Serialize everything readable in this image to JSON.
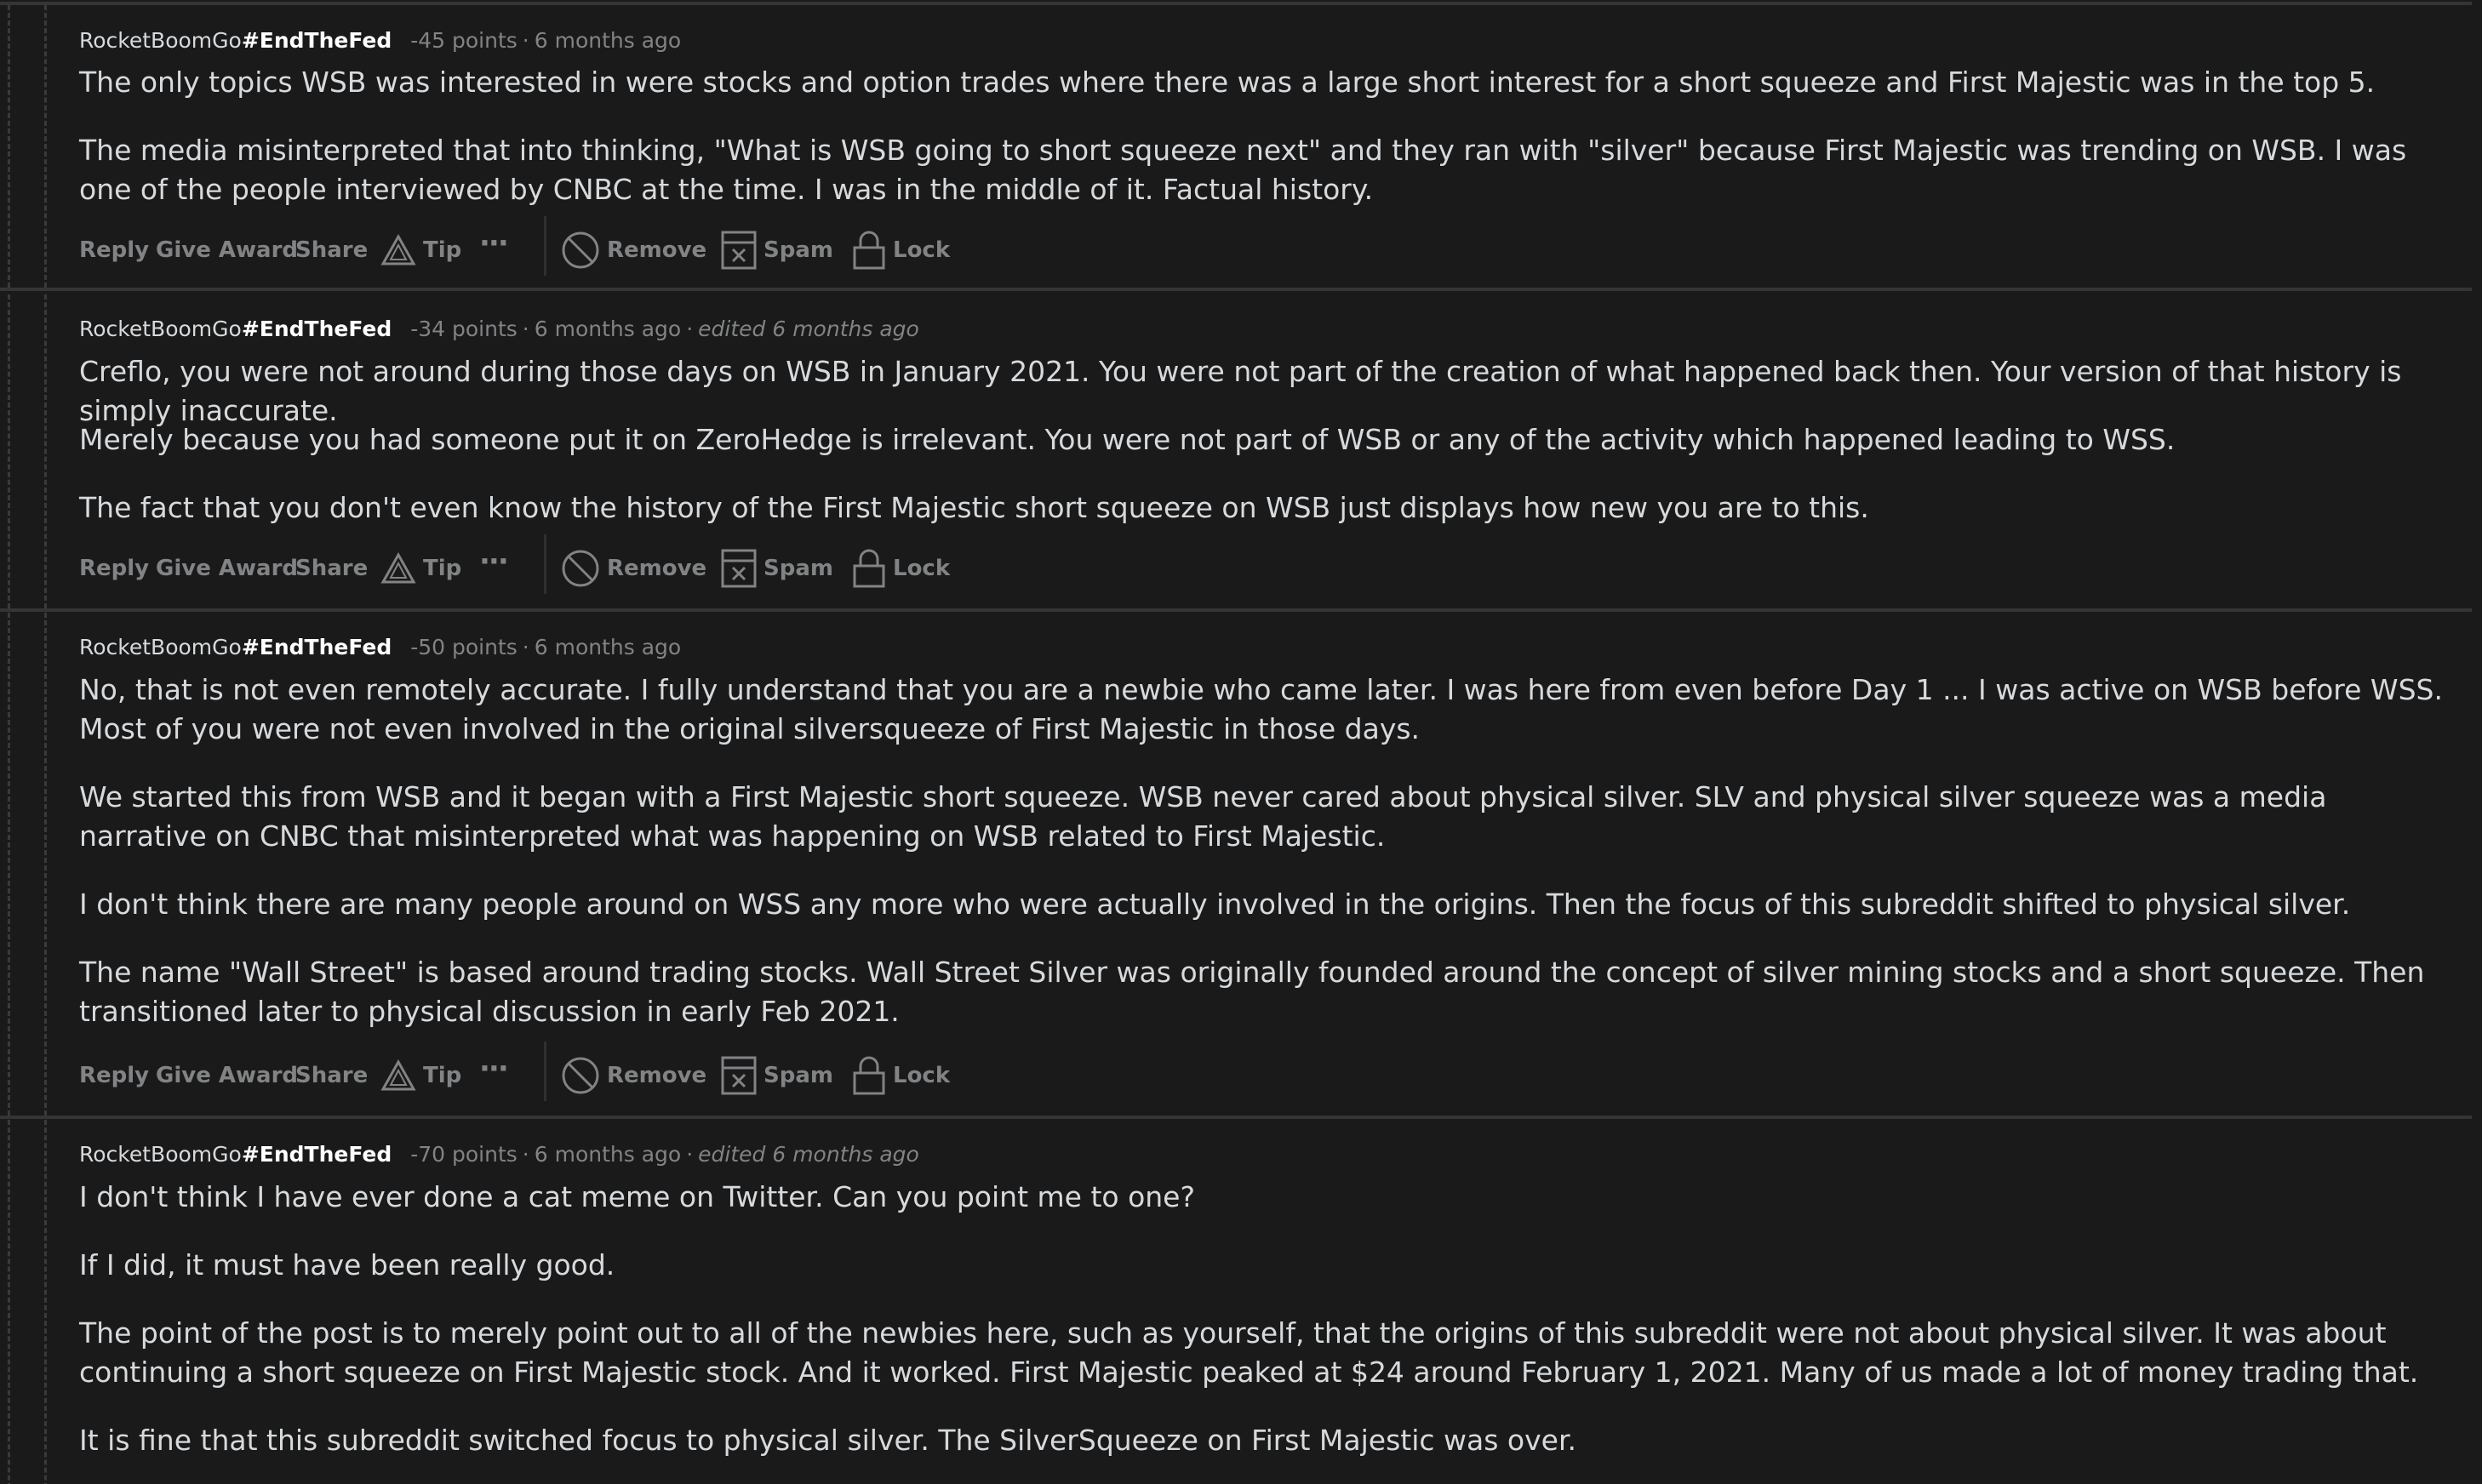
{
  "comments": [
    {
      "author": "RocketBoomGo",
      "flair": "#EndTheFed",
      "points": "-45 points",
      "time": "6 months ago",
      "edited": "",
      "paragraphs": [
        "The only topics WSB was interested in were stocks and option trades where there was a large short interest for a short squeeze and First Majestic was in the top 5.",
        "The media misinterpreted that into thinking, \"What is WSB going to short squeeze next\" and they ran with \"silver\" because First Majestic was trending on WSB. I was one of the people interviewed by CNBC at the time. I was in the middle of it. Factual history."
      ]
    },
    {
      "author": "RocketBoomGo",
      "flair": "#EndTheFed",
      "points": "-34 points",
      "time": "6 months ago",
      "edited": "edited 6 months ago",
      "paragraphs": [
        "Creflo, you were not around during those days on WSB in January 2021. You were not part of the creation of what happened back then. Your version of that history is simply inaccurate.",
        "Merely because you had someone put it on ZeroHedge is irrelevant. You were not part of WSB or any of the activity which happened leading to WSS.",
        "The fact that you don't even know the history of the First Majestic short squeeze on WSB just displays how new you are to this."
      ]
    },
    {
      "author": "RocketBoomGo",
      "flair": "#EndTheFed",
      "points": "-50 points",
      "time": "6 months ago",
      "edited": "",
      "paragraphs": [
        "No, that is not even remotely accurate. I fully understand that you are a newbie who came later. I was here from even before Day 1 ... I was active on WSB before WSS. Most of you were not even involved in the original silversqueeze of First Majestic in those days.",
        "We started this from WSB and it began with a First Majestic short squeeze. WSB never cared about physical silver. SLV and physical silver squeeze was a media narrative on CNBC that misinterpreted what was happening on WSB related to First Majestic.",
        "I don't think there are many people around on WSS any more who were actually involved in the origins. Then the focus of this subreddit shifted to physical silver.",
        "The name \"Wall Street\" is based around trading stocks. Wall Street Silver was originally founded around the concept of silver mining stocks and a short squeeze. Then transitioned later to physical discussion in early Feb 2021."
      ]
    },
    {
      "author": "RocketBoomGo",
      "flair": "#EndTheFed",
      "points": "-70 points",
      "time": "6 months ago",
      "edited": "edited 6 months ago",
      "paragraphs": [
        "I don't think I have ever done a cat meme on Twitter. Can you point me to one?",
        "If I did, it must have been really good.",
        "The point of the post is to merely point out to all of the newbies here, such as yourself, that the origins of this subreddit were not about physical silver. It was about continuing a short squeeze on First Majestic stock. And it worked. First Majestic peaked at $24 around February 1, 2021. Many of us made a lot of money trading that.",
        "It is fine that this subreddit switched focus to physical silver. The SilverSqueeze on First Majestic was over."
      ]
    }
  ],
  "actions": {
    "reply": "Reply",
    "give_award": "Give Award",
    "share": "Share",
    "tip": "Tip",
    "more": "···",
    "remove": "Remove",
    "spam": "Spam",
    "lock": "Lock"
  },
  "icons": {
    "tip": "tip-triangle-icon",
    "more": "more-options-icon",
    "remove": "remove-circle-icon",
    "spam": "spam-box-icon",
    "lock": "lock-icon"
  },
  "colors": {
    "background": "#1a1a1b",
    "text": "#d7dadc",
    "muted": "#818384",
    "divider": "#343536"
  }
}
